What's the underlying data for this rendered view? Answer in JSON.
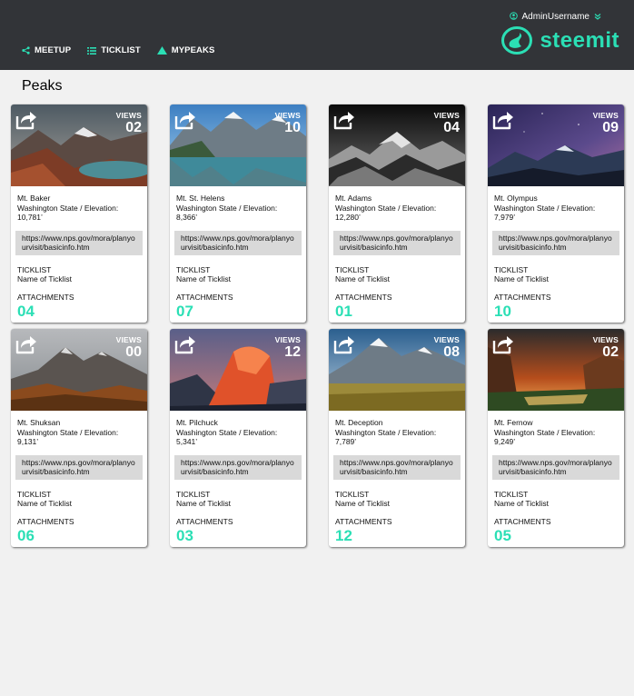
{
  "header": {
    "username": "AdminUsername",
    "nav": [
      {
        "label": "MEETUP",
        "icon": "share-icon"
      },
      {
        "label": "TICKLIST",
        "icon": "list-icon"
      },
      {
        "label": "MYPEAKS",
        "icon": "mountain-icon"
      }
    ],
    "logo_text": "steemit",
    "accent_color": "#2bdfb5",
    "bar_color": "#323438"
  },
  "page_title": "Peaks",
  "cards": [
    {
      "name": "Mt. Baker",
      "location": "Washington State / Elevation:",
      "elevation": "10,781’",
      "url": "https://www.nps.gov/mora/planyourvisit/basicinfo.htm",
      "views_label": "VIEWS",
      "views": "02",
      "ticklist_label": "TICKLIST",
      "ticklist_name": "Name of Ticklist",
      "attachments_label": "ATTACHMENTS",
      "attachments": "04"
    },
    {
      "name": "Mt. St. Helens",
      "location": "Washington State / Elevation:",
      "elevation": "8,366’",
      "url": "https://www.nps.gov/mora/planyourvisit/basicinfo.htm",
      "views_label": "VIEWS",
      "views": "10",
      "ticklist_label": "TICKLIST",
      "ticklist_name": "Name of Ticklist",
      "attachments_label": "ATTACHMENTS",
      "attachments": "07"
    },
    {
      "name": "Mt. Adams",
      "location": "Washington State / Elevation:",
      "elevation": "12,280’",
      "url": "https://www.nps.gov/mora/planyourvisit/basicinfo.htm",
      "views_label": "VIEWS",
      "views": "04",
      "ticklist_label": "TICKLIST",
      "ticklist_name": "Name of Ticklist",
      "attachments_label": "ATTACHMENTS",
      "attachments": "01"
    },
    {
      "name": "Mt. Olympus",
      "location": "Washington State / Elevation:",
      "elevation": "7,979’",
      "url": "https://www.nps.gov/mora/planyourvisit/basicinfo.htm",
      "views_label": "VIEWS",
      "views": "09",
      "ticklist_label": "TICKLIST",
      "ticklist_name": "Name of Ticklist",
      "attachments_label": "ATTACHMENTS",
      "attachments": "10"
    },
    {
      "name": "Mt. Shuksan",
      "location": "Washington State / Elevation:",
      "elevation": "9,131’",
      "url": "https://www.nps.gov/mora/planyourvisit/basicinfo.htm",
      "views_label": "VIEWS",
      "views": "00",
      "ticklist_label": "TICKLIST",
      "ticklist_name": "Name of Ticklist",
      "attachments_label": "ATTACHMENTS",
      "attachments": "06"
    },
    {
      "name": "Mt. Pilchuck",
      "location": "Washington State / Elevation:",
      "elevation": "5,341’",
      "url": "https://www.nps.gov/mora/planyourvisit/basicinfo.htm",
      "views_label": "VIEWS",
      "views": "12",
      "ticklist_label": "TICKLIST",
      "ticklist_name": "Name of Ticklist",
      "attachments_label": "ATTACHMENTS",
      "attachments": "03"
    },
    {
      "name": "Mt. Deception",
      "location": "Washington State / Elevation:",
      "elevation": "7,789’",
      "url": "https://www.nps.gov/mora/planyourvisit/basicinfo.htm",
      "views_label": "VIEWS",
      "views": "08",
      "ticklist_label": "TICKLIST",
      "ticklist_name": "Name of Ticklist",
      "attachments_label": "ATTACHMENTS",
      "attachments": "12"
    },
    {
      "name": "Mt. Fernow",
      "location": "Washington State / Elevation:",
      "elevation": "9,249’",
      "url": "https://www.nps.gov/mora/planyourvisit/basicinfo.htm",
      "views_label": "VIEWS",
      "views": "02",
      "ticklist_label": "TICKLIST",
      "ticklist_name": "Name of Ticklist",
      "attachments_label": "ATTACHMENTS",
      "attachments": "05"
    }
  ]
}
